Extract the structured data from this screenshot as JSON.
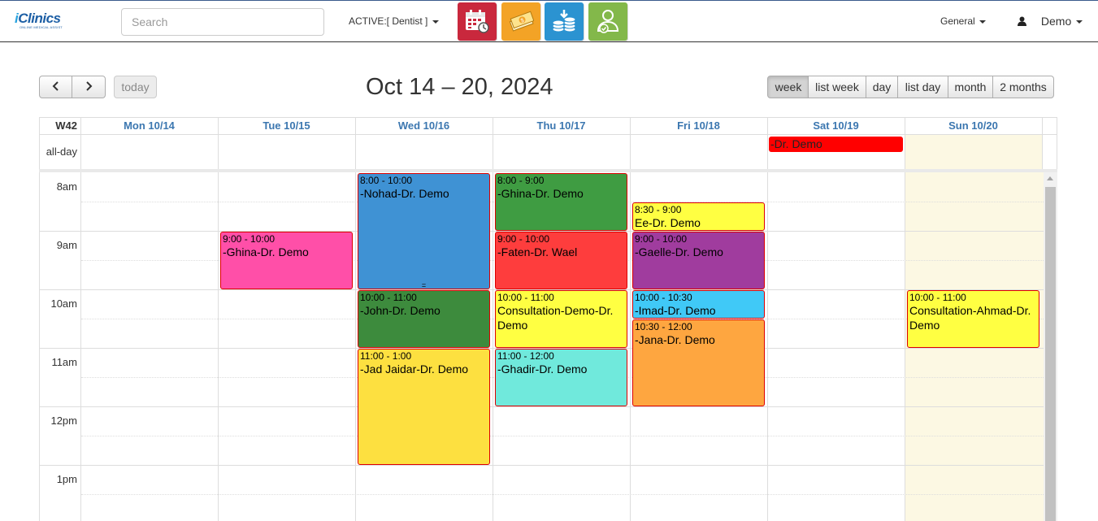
{
  "nav": {
    "logo_text_main": "Clinics",
    "logo_text_i": "i",
    "logo_tagline": "ONLINE MEDICAL ASSIST",
    "search_placeholder": "Search",
    "active_label": "ACTIVE:[ Dentist ]",
    "apps": [
      {
        "name": "calendar-app-icon",
        "color": "#c9283d"
      },
      {
        "name": "money-app-icon",
        "color": "#f3a326"
      },
      {
        "name": "coins-app-icon",
        "color": "#2b93d1"
      },
      {
        "name": "user-check-app-icon",
        "color": "#83b84a"
      }
    ],
    "general_label": "General",
    "user_label": "Demo"
  },
  "toolbar": {
    "prev_icon": "chevron-left-icon",
    "next_icon": "chevron-right-icon",
    "today_label": "today",
    "title": "Oct 14 – 20, 2024",
    "views": [
      "week",
      "list week",
      "day",
      "list day",
      "month",
      "2 months"
    ],
    "active_view": "week"
  },
  "calendar": {
    "week_label": "W42",
    "allday_label": "all-day",
    "days": [
      "Mon 10/14",
      "Tue 10/15",
      "Wed 10/16",
      "Thu 10/17",
      "Fri 10/18",
      "Sat 10/19",
      "Sun 10/20"
    ],
    "times": [
      "8am",
      "9am",
      "10am",
      "11am",
      "12pm",
      "1pm"
    ],
    "allday_events": [
      {
        "day": 5,
        "title": "-Dr. Demo",
        "color": "#ff0000"
      }
    ],
    "events": [
      {
        "day": 1,
        "start": 9,
        "end": 10,
        "time": "9:00 - 10:00",
        "title": "-Ghina-Dr. Demo",
        "color": "#ff4fa8"
      },
      {
        "day": 2,
        "start": 8,
        "end": 10,
        "time": "8:00 - 10:00",
        "title": "-Nohad-Dr. Demo",
        "color": "#3f92d4"
      },
      {
        "day": 2,
        "start": 10,
        "end": 11,
        "time": "10:00 - 11:00",
        "title": "-John-Dr. Demo",
        "color": "#3d8b3d"
      },
      {
        "day": 2,
        "start": 11,
        "end": 13,
        "time": "11:00 - 1:00",
        "title": "-Jad Jaidar-Dr. Demo",
        "color": "#fde040"
      },
      {
        "day": 3,
        "start": 8,
        "end": 9,
        "time": "8:00 - 9:00",
        "title": "-Ghina-Dr. Demo",
        "color": "#3f9c42"
      },
      {
        "day": 3,
        "start": 9,
        "end": 10,
        "time": "9:00 - 10:00",
        "title": "-Faten-Dr. Wael",
        "color": "#fe3d3d"
      },
      {
        "day": 3,
        "start": 10,
        "end": 11,
        "time": "10:00 - 11:00",
        "title": "Consultation-Demo-Dr. Demo",
        "color": "#ffff42"
      },
      {
        "day": 3,
        "start": 11,
        "end": 12,
        "time": "11:00 - 12:00",
        "title": "-Ghadir-Dr. Demo",
        "color": "#70e9dc"
      },
      {
        "day": 4,
        "start": 8.5,
        "end": 9,
        "time": "8:30 - 9:00",
        "title": "Ee-Dr. Demo",
        "color": "#ffff42"
      },
      {
        "day": 4,
        "start": 9,
        "end": 10,
        "time": "9:00 - 10:00",
        "title": "-Gaelle-Dr. Demo",
        "color": "#a03c9e"
      },
      {
        "day": 4,
        "start": 10,
        "end": 10.5,
        "time": "10:00 - 10:30",
        "title": "-Imad-Dr. Demo",
        "color": "#40c9f7"
      },
      {
        "day": 4,
        "start": 10.5,
        "end": 12,
        "time": "10:30 - 12:00",
        "title": "-Jana-Dr. Demo",
        "color": "#fea640"
      },
      {
        "day": 6,
        "start": 10,
        "end": 11,
        "time": "10:00 - 11:00",
        "title": "Consultation-Ahmad-Dr. Demo",
        "color": "#ffff42"
      }
    ]
  }
}
